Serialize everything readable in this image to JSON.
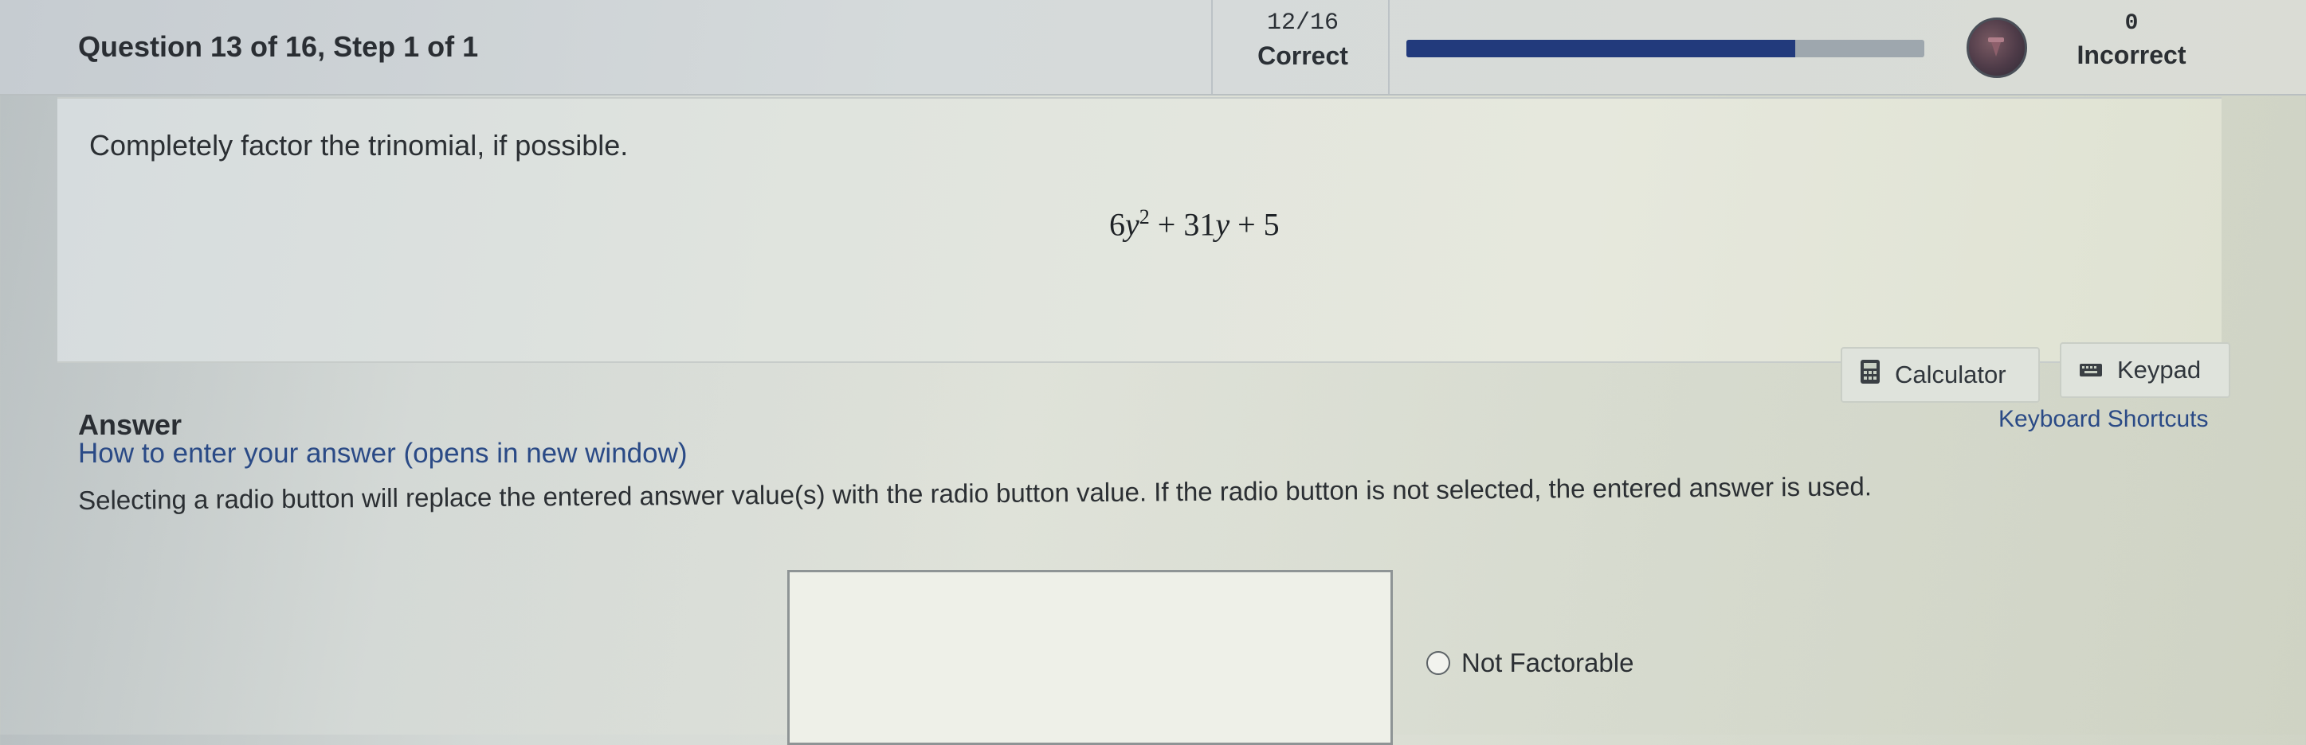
{
  "header": {
    "question_title": "Question 13 of 16,  Step 1 of 1",
    "score_fraction": "12/16",
    "correct_label": "Correct",
    "progress_fraction": 0.75,
    "incorrect_count": "0",
    "incorrect_label": "Incorrect",
    "progress_color": "#223a7c"
  },
  "question": {
    "prompt": "Completely factor the trinomial, if possible.",
    "expression": {
      "term1_coef": "6",
      "term1_var": "y",
      "term1_exp": "2",
      "op1": "+",
      "term2_coef": "31",
      "term2_var": "y",
      "op2": "+",
      "constant": "5"
    }
  },
  "tools": {
    "calculator_label": "Calculator",
    "calculator_icon": "calculator-icon",
    "keypad_label": "Keypad",
    "keypad_icon": "keyboard-icon"
  },
  "answer": {
    "heading": "Answer",
    "help_link": "How to enter your answer (opens in new window)",
    "shortcuts_link": "Keyboard Shortcuts",
    "instructions": "Selecting a radio button will replace the entered answer value(s) with the radio button value. If the radio button is not selected, the entered answer is used.",
    "input_value": "",
    "radio_label": "Not Factorable",
    "radio_selected": false
  }
}
